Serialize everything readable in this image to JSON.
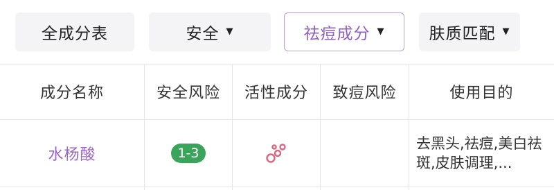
{
  "filters": {
    "all": "全成分表",
    "safety": "安全",
    "acne": "祛痘成分",
    "skin": "肤质匹配"
  },
  "table": {
    "headers": [
      "成分名称",
      "安全风险",
      "活性成分",
      "致痘风险",
      "使用目的"
    ],
    "rows": [
      {
        "name": "水杨酸",
        "safety_risk": "1-3",
        "active_icon": "molecule-icon",
        "acne_risk": "",
        "usage": "去黑头,祛痘,美白祛斑,皮肤调理,..."
      }
    ]
  },
  "colors": {
    "accent": "#9b64c9",
    "active_border": "#b99ad8",
    "risk_badge": "#3aa55a",
    "active_icon": "#d9667f",
    "button_bg": "#f4f4f6",
    "grid": "#e6e6e9"
  }
}
